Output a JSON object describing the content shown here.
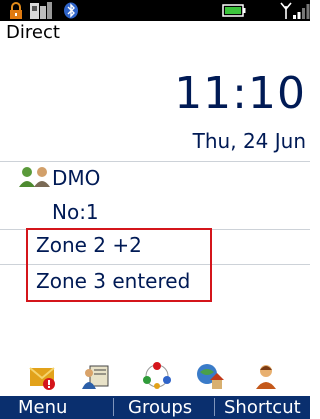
{
  "status_bar": {
    "icons": [
      "lock-icon",
      "device-icon",
      "bluetooth-icon",
      "battery-icon",
      "antenna-icon",
      "signal-bars-icon"
    ]
  },
  "mode_label": "Direct",
  "clock": {
    "time": "11:10",
    "date": "Thu, 24 Jun"
  },
  "group": {
    "icon": "group-users-icon",
    "name": "DMO",
    "number": "No:1"
  },
  "messages": [
    "Zone 2 +2",
    "Zone 3 entered"
  ],
  "highlight_color": "#d4151b",
  "dock_icons": [
    "mail-alert-icon",
    "contacts-icon",
    "network-icon",
    "home-globe-icon",
    "user-icon"
  ],
  "softkeys": {
    "left": "Menu",
    "middle": "Groups",
    "right": "Shortcut"
  },
  "colors": {
    "softkey_bar": "#0a2f6e",
    "text": "#001a55"
  }
}
